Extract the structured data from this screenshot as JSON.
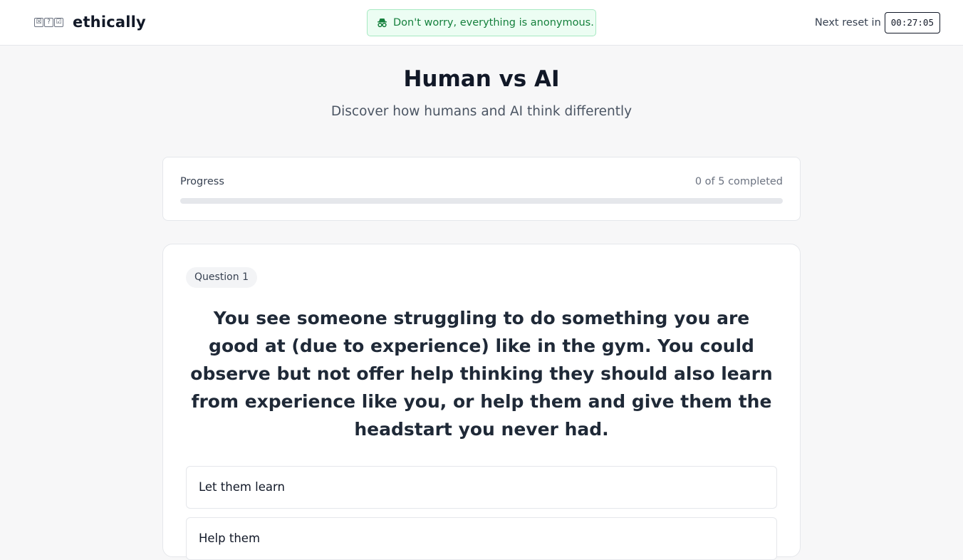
{
  "header": {
    "brand": "ethically",
    "logo_glyphs": [
      "☒",
      "?",
      "☑"
    ],
    "anon_icon": "incognito-icon",
    "anon_message": "Don't worry, everything is anonymous.",
    "reset_label": "Next reset in",
    "reset_timer": "00:27:05"
  },
  "page": {
    "title": "Human vs AI",
    "subtitle": "Discover how humans and AI think differently"
  },
  "progress": {
    "label": "Progress",
    "status": "0 of 5 completed",
    "completed": 0,
    "total": 5
  },
  "question": {
    "badge": "Question 1",
    "text": "You see someone struggling to do something you are good at (due to experience) like in the gym. You could observe but not offer help thinking they should also learn from experience like you, or help them and give them the headstart you never had.",
    "options": [
      {
        "label": "Let them learn"
      },
      {
        "label": "Help them"
      }
    ]
  },
  "colors": {
    "accent_green": "#15803d",
    "banner_bg": "#ecfdf3",
    "text_primary": "#111827"
  }
}
